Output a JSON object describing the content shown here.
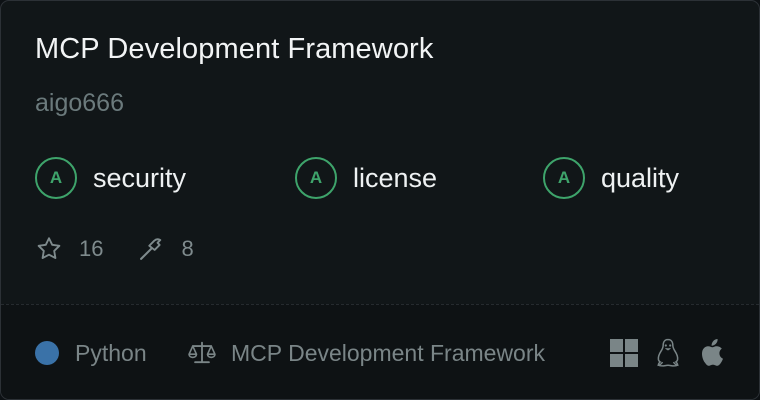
{
  "card": {
    "title": "MCP Development Framework",
    "owner": "aigo666"
  },
  "grades": [
    {
      "grade": "A",
      "label": "security"
    },
    {
      "grade": "A",
      "label": "license"
    },
    {
      "grade": "A",
      "label": "quality"
    }
  ],
  "stats": {
    "stars": "16",
    "tools": "8"
  },
  "footer": {
    "language": "Python",
    "language_color": "#3a72a8",
    "license_name": "MCP Development Framework",
    "platforms": [
      "windows-icon",
      "linux-icon",
      "apple-icon"
    ]
  },
  "colors": {
    "grade_accent": "#3ea46b",
    "background": "#111618"
  }
}
